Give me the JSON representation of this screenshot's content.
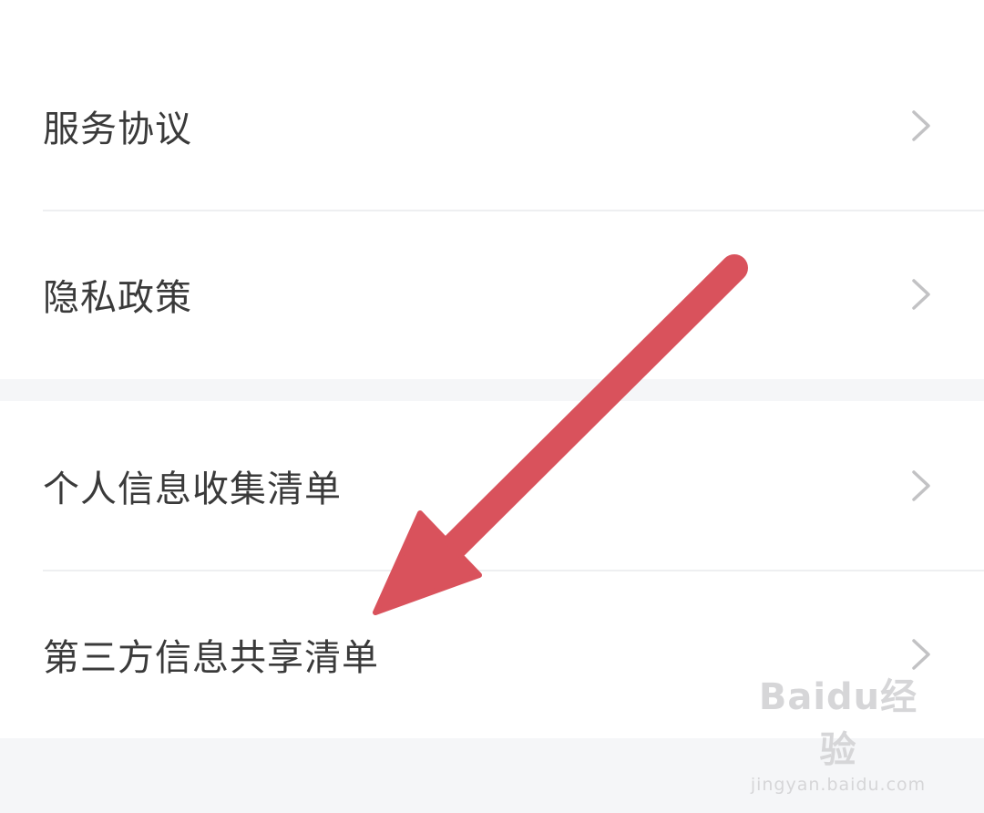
{
  "settings": {
    "items": [
      {
        "label": "服务协议"
      },
      {
        "label": "隐私政策"
      },
      {
        "label": "个人信息收集清单"
      },
      {
        "label": "第三方信息共享清单"
      }
    ]
  },
  "annotation": {
    "arrow_color": "#d9525c"
  },
  "watermark": {
    "logo": "Baidu经验",
    "url": "jingyan.baidu.com"
  },
  "colors": {
    "background": "#f5f6f8",
    "card": "#ffffff",
    "text": "#3a3a3a",
    "chevron": "#c2c2c4",
    "divider": "#eeeff1"
  }
}
